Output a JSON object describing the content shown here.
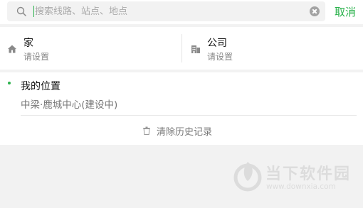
{
  "search": {
    "placeholder": "搜索线路、站点、地点",
    "cancel_label": "取消"
  },
  "shortcuts": [
    {
      "title": "家",
      "subtitle": "请设置",
      "icon": "home-icon"
    },
    {
      "title": "公司",
      "subtitle": "请设置",
      "icon": "building-icon"
    }
  ],
  "history": {
    "items": [
      {
        "title": "我的位置",
        "subtitle": "中梁·鹿城中心(建设中)"
      }
    ],
    "clear_label": "清除历史记录"
  },
  "watermark": {
    "title": "当下软件园",
    "url": "www.downxia.com"
  },
  "colors": {
    "accent": "#2bb24c",
    "background": "#f2f2f2"
  }
}
